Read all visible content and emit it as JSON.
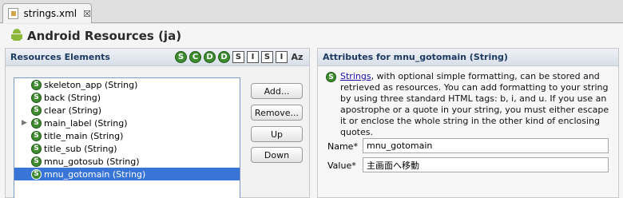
{
  "tab": {
    "title": "strings.xml",
    "close": "☒"
  },
  "header": {
    "title": "Android Resources (ja)"
  },
  "left": {
    "title": "Resources Elements",
    "filters": [
      {
        "type": "circle",
        "letter": "S"
      },
      {
        "type": "circle",
        "letter": "C"
      },
      {
        "type": "circle",
        "letter": "D"
      },
      {
        "type": "circle",
        "letter": "D"
      },
      {
        "type": "square",
        "letter": "S"
      },
      {
        "type": "square",
        "letter": "I"
      },
      {
        "type": "square",
        "letter": "S"
      },
      {
        "type": "square",
        "letter": "I"
      },
      {
        "type": "az",
        "letter": "Az"
      }
    ],
    "items": [
      {
        "icon": "S",
        "label": "skeleton_app (String)"
      },
      {
        "icon": "S",
        "label": "back (String)"
      },
      {
        "icon": "S",
        "label": "clear (String)"
      },
      {
        "icon": "S",
        "label": "main_label (String)",
        "expandable": true
      },
      {
        "icon": "S",
        "label": "title_main (String)"
      },
      {
        "icon": "S",
        "label": "title_sub (String)"
      },
      {
        "icon": "S",
        "label": "mnu_gotosub (String)"
      },
      {
        "icon": "S",
        "label": "mnu_gotomain (String)",
        "selected": true
      }
    ],
    "buttons": {
      "add": "Add...",
      "remove": "Remove...",
      "up": "Up",
      "down": "Down"
    }
  },
  "right": {
    "title": "Attributes for mnu_gotomain (String)",
    "desc_link": "Strings",
    "desc_rest": ", with optional simple formatting, can be stored and retrieved as resources. You can add formatting to your string by using three standard HTML tags: b, i, and u. If you use an apostrophe or a quote in your string, you must either escape it or enclose the whole string in the other kind of enclosing quotes.",
    "name_label": "Name*",
    "name_value": "mnu_gotomain",
    "value_label": "Value*",
    "value_value": "主画面へ移動"
  }
}
